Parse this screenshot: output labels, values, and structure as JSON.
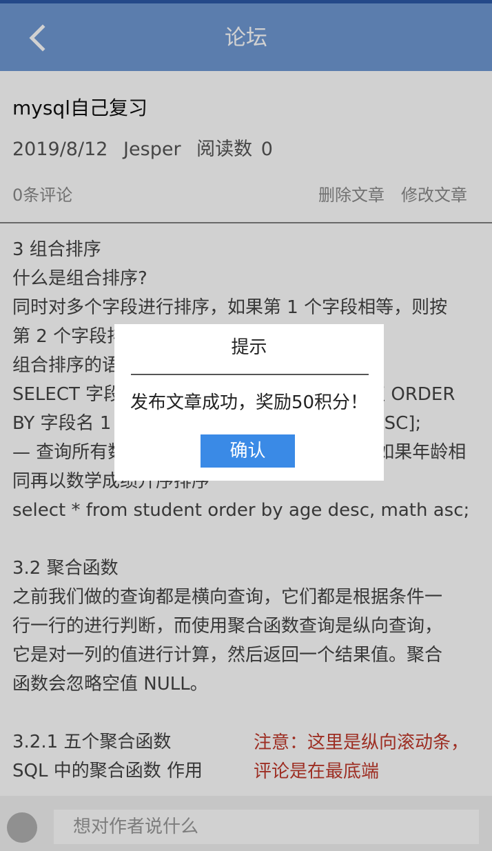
{
  "header": {
    "title": "论坛",
    "back_icon": "chevron-left-icon"
  },
  "post": {
    "title": "mysql自己复习",
    "date": "2019/8/12",
    "author": "Jesper",
    "read_label": "阅读数",
    "read_count": "0",
    "comment_count": "0条评论",
    "delete_label": "删除文章",
    "edit_label": "修改文章"
  },
  "article": {
    "lines": [
      "3 组合排序",
      "什么是组合排序?",
      "同时对多个字段进行排序，如果第 1 个字段相等，则按",
      "第 2 个字段排序，依次类推。",
      "组合排序的语法：",
      "SELECT 字段名 FROM 表名 WHERE 字段=值 ORDER",
      " BY 字段名 1 [ASC|DESC], 字段名 2 [ASC|DESC];",
      "— 查询所有数据，在年龄降序排序的基础上，如果年龄相",
      "同再以数学成绩升序排序",
      "select * from student order by age desc, math asc;",
      "",
      "3.2 聚合函数",
      "之前我们做的查询都是横向查询，它们都是根据条件一",
      "行一行的进行判断，而使用聚合函数查询是纵向查询，",
      "它是对一列的值进行计算，然后返回一个结果值。聚合",
      "函数会忽略空值 NULL。",
      "",
      "3.2.1 五个聚合函数",
      "SQL 中的聚合函数 作用"
    ]
  },
  "note": {
    "line1": "注意：这里是纵向滚动条，",
    "line2": "评论是在最底端",
    "color": "#c0392b"
  },
  "dialog": {
    "title": "提示",
    "message": "发布文章成功，奖励50积分！",
    "confirm_label": "确认",
    "button_color": "#3a8ae6"
  },
  "comment_bar": {
    "placeholder": "想对作者说什么",
    "avatar_icon": "avatar"
  },
  "colors": {
    "header_bg": "#7099d4",
    "accent": "#3a8ae6"
  }
}
